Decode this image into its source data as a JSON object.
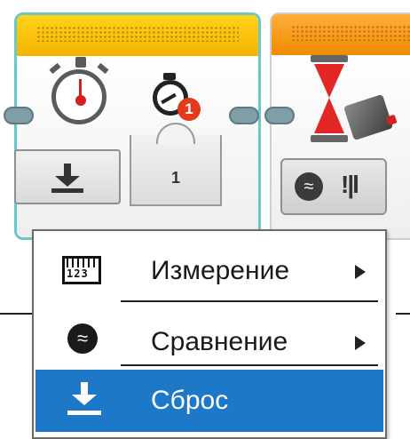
{
  "blocks": {
    "timer": {
      "value": "1",
      "badge": "1"
    },
    "wait": {
      "bars_icon": "!|l"
    }
  },
  "menu": {
    "items": [
      {
        "label": "Измерение",
        "icon": "ruler-123-icon",
        "has_submenu": true,
        "selected": false
      },
      {
        "label": "Сравнение",
        "icon": "compare-icon",
        "has_submenu": true,
        "selected": false
      },
      {
        "label": "Сброс",
        "icon": "reset-download-icon",
        "has_submenu": false,
        "selected": true
      }
    ]
  },
  "colors": {
    "timer_bar": "#f4b400",
    "wait_bar": "#f08a00",
    "selection": "#1e78c8",
    "timer_border": "#6cc7c9"
  }
}
